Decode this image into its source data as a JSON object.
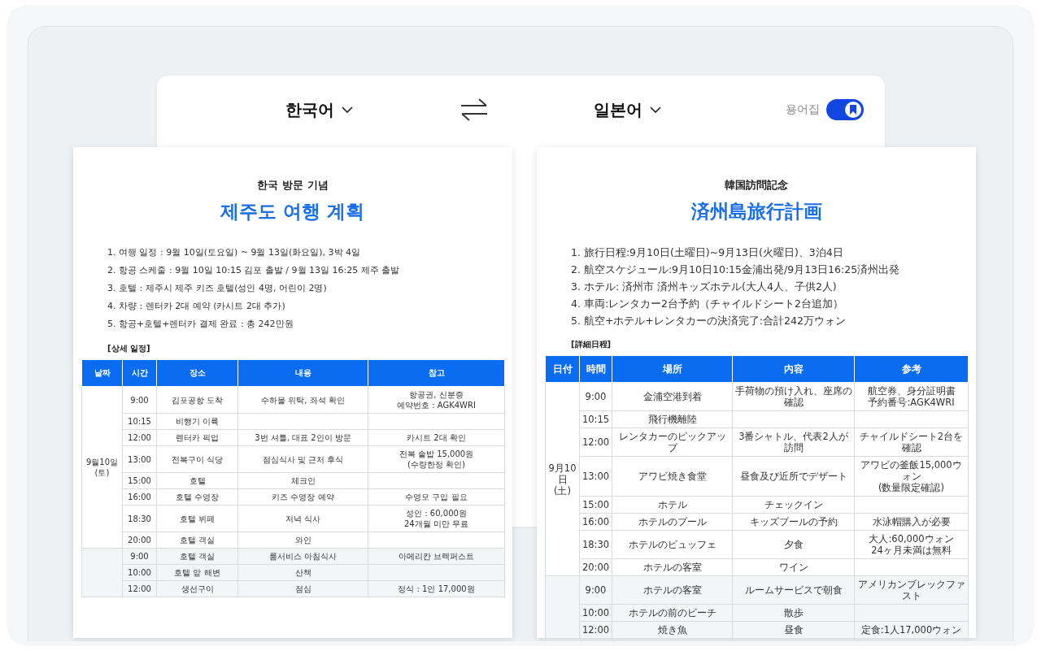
{
  "header": {
    "source_language": "한국어",
    "target_language": "일본어",
    "glossary": {
      "label": "용어집",
      "on": true
    }
  },
  "documents": [
    {
      "subtitle": "한국 방문 기념",
      "title": "제주도 여행 계획",
      "items": [
        "1. 여행 일정 : 9월 10일(토요일) ~ 9월 13일(화요일), 3박 4일",
        "2. 항공 스케줄 : 9월 10일 10:15 김포 출발 / 9월 13일 16:25 제주 출발",
        "3. 호텔 : 제주시 제주 키즈 호텔(성인 4명, 어린이 2명)",
        "4. 차량 : 렌터카 2대 예약 (카시트 2대 추가)",
        "5. 항공+호텔+렌터카 결제 완료 : 총 242만원"
      ],
      "section": "[상세 일정]",
      "columns": [
        "날짜",
        "시간",
        "장소",
        "내용",
        "참고"
      ],
      "groups": [
        {
          "date": [
            "9월10일",
            "(토)"
          ],
          "rows": [
            [
              "9:00",
              "김포공항 도착",
              "수하물 위탁, 좌석 확인",
              [
                "항공권, 신분증",
                "예약번호 : AGK4WRI"
              ]
            ],
            [
              "10:15",
              "비행기 이륙",
              "",
              ""
            ],
            [
              "12:00",
              "렌터카 픽업",
              "3번 셔틀, 대표 2인이 방문",
              "카시트 2대 확인"
            ],
            [
              "13:00",
              "전복구이 식당",
              "점심식사 및 근처 후식",
              [
                "전복 솥밥 15,000원",
                "(수량한정 확인)"
              ]
            ],
            [
              "15:00",
              "호텔",
              "체크인",
              ""
            ],
            [
              "16:00",
              "호텔 수영장",
              "키즈 수영장 예약",
              "수영모 구입 필요"
            ],
            [
              "18:30",
              "호텔 뷔페",
              "저녁 식사",
              [
                "성인 : 60,000원",
                "24개월 미만 무료"
              ]
            ],
            [
              "20:00",
              "호텔 객실",
              "와인",
              ""
            ]
          ]
        },
        {
          "rows": [
            [
              "9:00",
              "호텔 객실",
              "룸서비스 아침식사",
              "아메리칸 브렉퍼스트"
            ],
            [
              "10:00",
              "호텔 앞 해변",
              "산책",
              ""
            ],
            [
              "12:00",
              "생선구이",
              "점심",
              "정식 : 1인 17,000원"
            ]
          ]
        }
      ]
    },
    {
      "subtitle": "韓国訪問記念",
      "title": "済州島旅行計画",
      "items": [
        "1. 旅行日程:9月10日(土曜日)~9月13日(火曜日)、3泊4日",
        "2. 航空スケジュール:9月10日10:15金浦出発/9月13日16:25済州出発",
        "3. ホテル: 済州市 済州キッズホテル(大人4人、子供2人)",
        "4. 車両:レンタカー2台予約（チャイルドシート2台追加）",
        "5. 航空+ホテル+レンタカーの決済完了:合計242万ウォン"
      ],
      "section": "[詳細日程]",
      "columns": [
        "日付",
        "時間",
        "場所",
        "内容",
        "参考"
      ],
      "groups": [
        {
          "date": [
            "9月10日",
            "(土)"
          ],
          "rows": [
            [
              "9:00",
              "金浦空港到着",
              "手荷物の預け入れ、座席の確認",
              [
                "航空券、身分証明書",
                "予約番号:AGK4WRI"
              ]
            ],
            [
              "10:15",
              "飛行機離陸",
              "",
              ""
            ],
            [
              "12:00",
              "レンタカーのピックアップ",
              "3番シャトル、代表2人が訪問",
              "チャイルドシート2台を確認"
            ],
            [
              "13:00",
              "アワビ焼き食堂",
              "昼食及び近所でデザート",
              [
                "アワビの釜飯15,000ウォン",
                "(数量限定確認)"
              ]
            ],
            [
              "15:00",
              "ホテル",
              "チェックイン",
              ""
            ],
            [
              "16:00",
              "ホテルのプール",
              "キッズプールの予約",
              "水泳帽購入が必要"
            ],
            [
              "18:30",
              "ホテルのビュッフェ",
              "夕食",
              [
                "大人:60,000ウォン",
                "24ヶ月未満は無料"
              ]
            ],
            [
              "20:00",
              "ホテルの客室",
              "ワイン",
              ""
            ]
          ]
        },
        {
          "rows": [
            [
              "9:00",
              "ホテルの客室",
              "ルームサービスで朝食",
              "アメリカンブレックファスト"
            ],
            [
              "10:00",
              "ホテルの前のビーチ",
              "散歩",
              ""
            ],
            [
              "12:00",
              "焼き魚",
              "昼食",
              "定食:1人17,000ウォン"
            ]
          ]
        }
      ]
    }
  ]
}
